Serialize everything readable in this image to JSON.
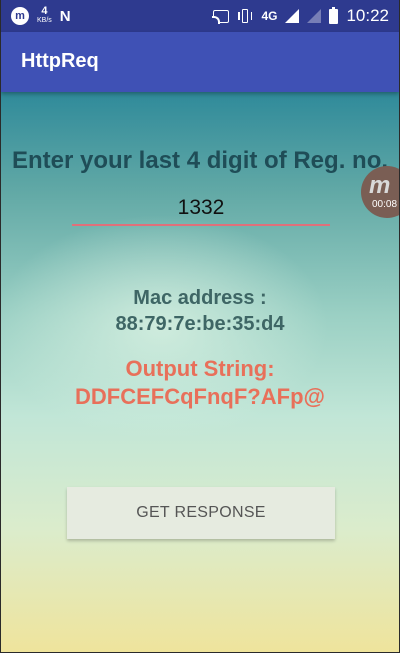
{
  "status_bar": {
    "net_speed_value": "4",
    "net_speed_unit": "KB/s",
    "network_type": "4G",
    "time": "10:22",
    "icons": [
      "m-app-icon",
      "n-icon",
      "cast-icon",
      "vibrate-icon",
      "signal-icon",
      "signal-empty-icon",
      "battery-icon"
    ]
  },
  "app_bar": {
    "title": "HttpReq"
  },
  "form": {
    "prompt": "Enter your last 4 digit of Reg. no.",
    "reg_value": "1332"
  },
  "result": {
    "mac_label": "Mac address :",
    "mac_value": "88:79:7e:be:35:d4",
    "output_label": "Output String:",
    "output_value": "DDFCEFCqFnqF?AFp@"
  },
  "actions": {
    "get_response_label": "GET RESPONSE"
  },
  "floating_recorder": {
    "glyph": "m",
    "timer": "00:08"
  },
  "colors": {
    "status_bar": "#2e3a8f",
    "app_bar": "#3f51b5",
    "prompt_text": "#1f4d57",
    "mac_text": "#3e6665",
    "output_text": "#e8705a",
    "input_underline": "#e0707a"
  }
}
